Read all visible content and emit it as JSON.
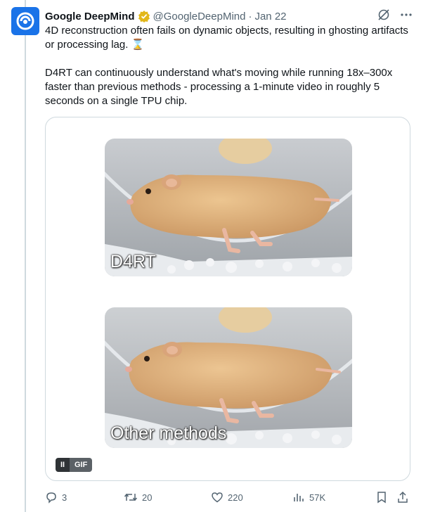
{
  "tweet": {
    "author_name": "Google DeepMind",
    "handle": "@GoogleDeepMind",
    "separator": "·",
    "date": "Jan 22",
    "text_paragraph_1": "4D reconstruction often fails on dynamic objects, resulting in ghosting artifacts or processing lag. ⌛",
    "text_paragraph_2": "D4RT can continuously understand what's moving while running 18x–300x faster than previous methods - processing a 1-minute video in roughly 5 seconds on a single TPU chip."
  },
  "media": {
    "panel_top_label": "D4RT",
    "panel_bottom_label": "Other methods",
    "gif_badge": "GIF",
    "pause_glyph": "II"
  },
  "actions": {
    "replies": "3",
    "reposts": "20",
    "likes": "220",
    "views": "57K"
  },
  "colors": {
    "brand": "#1a73e8",
    "verified_gold": "#e2b719",
    "muted_text": "#536471"
  },
  "icons": [
    "deepmind-logo-icon",
    "verified-badge-icon",
    "grok-icon",
    "more-icon",
    "reply-icon",
    "repost-icon",
    "like-icon",
    "views-icon",
    "bookmark-icon",
    "share-icon"
  ]
}
